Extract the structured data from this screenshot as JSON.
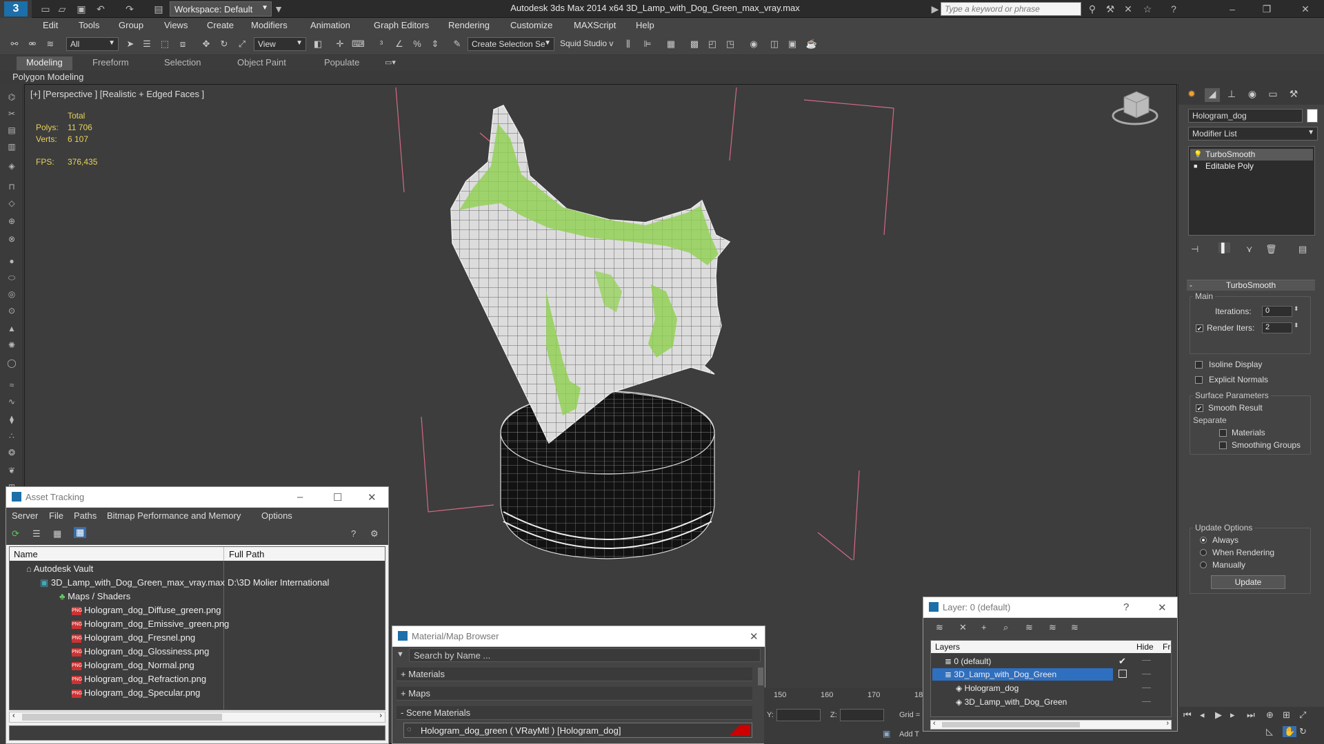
{
  "titlebar": {
    "workspace": "Workspace: Default",
    "app_title": "Autodesk 3ds Max  2014 x64     3D_Lamp_with_Dog_Green_max_vray.max",
    "search_placeholder": "Type a keyword or phrase"
  },
  "menu": [
    "Edit",
    "Tools",
    "Group",
    "Views",
    "Create",
    "Modifiers",
    "Animation",
    "Graph Editors",
    "Rendering",
    "Customize",
    "MAXScript",
    "Help"
  ],
  "toolbar": {
    "filter": "All",
    "refcoord": "View",
    "selection_set": "Create Selection Se",
    "squid": "Squid Studio v"
  },
  "ribbon": {
    "tabs": [
      "Modeling",
      "Freeform",
      "Selection",
      "Object Paint",
      "Populate"
    ],
    "active_tab": "Modeling",
    "subpanel": "Polygon Modeling"
  },
  "viewport": {
    "label": "[+] [Perspective ] [Realistic + Edged Faces ]",
    "stats": {
      "total_label": "Total",
      "polys_label": "Polys:",
      "polys": "11 706",
      "verts_label": "Verts:",
      "verts": "6 107",
      "fps_label": "FPS:",
      "fps": "376,435"
    }
  },
  "cmdpanel": {
    "object_name": "Hologram_dog",
    "modifier_list": "Modifier List",
    "stack": [
      "TurboSmooth",
      "Editable Poly"
    ],
    "rollout": "TurboSmooth",
    "main_group": "Main",
    "iterations_label": "Iterations:",
    "iterations": "0",
    "render_iters_label": "Render Iters:",
    "render_iters": "2",
    "isoline": "Isoline Display",
    "explicit_normals": "Explicit Normals",
    "surface_group": "Surface Parameters",
    "smooth_result": "Smooth Result",
    "separate": "Separate",
    "materials": "Materials",
    "smoothing_groups": "Smoothing Groups",
    "update_group": "Update Options",
    "always": "Always",
    "when_rendering": "When Rendering",
    "manually": "Manually",
    "update_btn": "Update"
  },
  "asset_tracking": {
    "title": "Asset Tracking",
    "menu": [
      "Server",
      "File",
      "Paths",
      "Bitmap Performance and Memory",
      "Options"
    ],
    "col_name": "Name",
    "col_path": "Full Path",
    "vault": "Autodesk Vault",
    "file": "3D_Lamp_with_Dog_Green_max_vray.max",
    "file_path": "D:\\3D Molier International",
    "maps_folder": "Maps / Shaders",
    "maps": [
      "Hologram_dog_Diffuse_green.png",
      "Hologram_dog_Emissive_green.png",
      "Hologram_dog_Fresnel.png",
      "Hologram_dog_Glossiness.png",
      "Hologram_dog_Normal.png",
      "Hologram_dog_Refraction.png",
      "Hologram_dog_Specular.png"
    ]
  },
  "material_browser": {
    "title": "Material/Map Browser",
    "search_placeholder": "Search by Name ...",
    "sections": [
      "+ Materials",
      "+ Maps",
      "- Scene Materials"
    ],
    "scene_material": "Hologram_dog_green ( VRayMtl ) [Hologram_dog]"
  },
  "layer_window": {
    "title": "Layer: 0 (default)",
    "col_layers": "Layers",
    "col_hide": "Hide",
    "col_fr": "Fr",
    "layers": [
      "0 (default)",
      "3D_Lamp_with_Dog_Green",
      "Hologram_dog",
      "3D_Lamp_with_Dog_Green"
    ]
  },
  "timeline": {
    "ticks": [
      "150",
      "160",
      "170",
      "18"
    ]
  },
  "status": {
    "y_label": "Y:",
    "z_label": "Z:",
    "grid_label": "Grid =",
    "add_t": "Add T"
  }
}
